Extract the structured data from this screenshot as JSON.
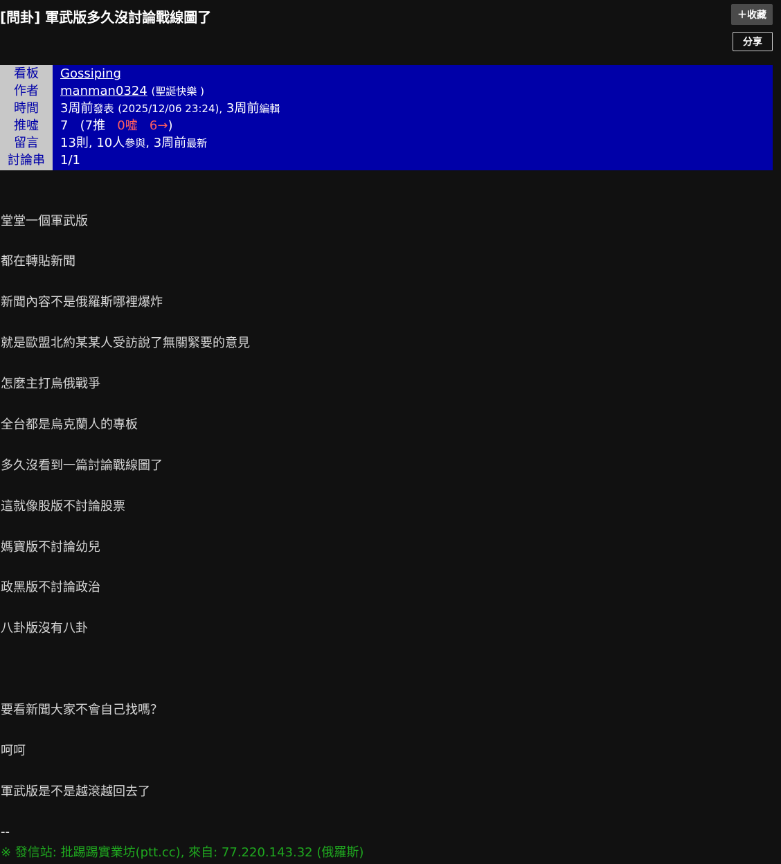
{
  "post": {
    "title": "[問卦] 軍武版多久沒討論戰線圖了"
  },
  "actions": {
    "favorite_label": "＋收藏",
    "share_label": "分享"
  },
  "meta": {
    "board": {
      "label": "看板",
      "value": "Gossiping"
    },
    "author": {
      "label": "作者",
      "id": "manman0324",
      "nickname": "(聖誕快樂 )"
    },
    "time": {
      "label": "時間",
      "posted_ago": "3周前",
      "posted_word": "發表",
      "posted_date": "(2025/12/06 23:24),",
      "edited_ago": "3周前",
      "edited_word": "編輯"
    },
    "votes": {
      "label": "推噓",
      "score": "7",
      "open": "(7推",
      "boo": "0噓",
      "arrow": "6→",
      "close": ")"
    },
    "comments": {
      "label": "留言",
      "count_text": "13則, 10人",
      "participants_word": "參與",
      "latest_ago": ", 3周前",
      "latest_word": "最新"
    },
    "thread": {
      "label": "討論串",
      "value": "1/1"
    }
  },
  "content": {
    "lines": [
      "堂堂一個軍武版",
      "都在轉貼新聞",
      "新聞內容不是俄羅斯哪裡爆炸",
      "就是歐盟北約某某人受訪說了無關緊要的意見",
      "怎麼主打烏俄戰爭",
      "全台都是烏克蘭人的專板",
      "多久沒看到一篇討論戰線圖了",
      "這就像股版不討論股票",
      "媽寶版不討論幼兒",
      "政黑版不討論政治",
      "八卦版沒有八卦",
      "要看新聞大家不會自己找嗎？",
      "呵呵",
      "軍武版是不是越滾越回去了"
    ],
    "separator": "--",
    "signature": "※ 發信站: 批踢踢實業坊(ptt.cc), 來自: 77.220.143.32 (俄羅斯)"
  }
}
